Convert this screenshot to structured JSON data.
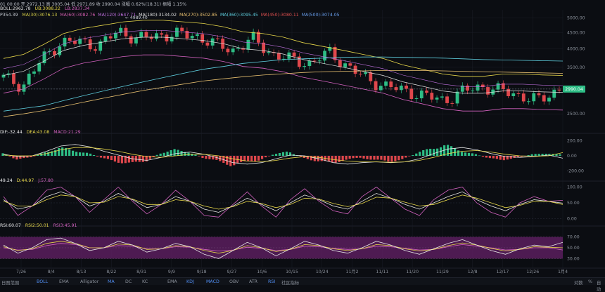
{
  "header": {
    "ohlc_line": "01 00:00  开 2972.13  高 3005.04  低 2971.89  收 2990.04  涨幅 0.62%(18.31)  振幅 1.15%",
    "boll_label": "BOLL:2962.78",
    "boll_ub": "UB:3088.22",
    "boll_lb": "LB:2837.34",
    "ma_line_prefix": "P354.39",
    "ma_values": [
      {
        "text": "MA(30):3076.13",
        "color": "#d9d24a"
      },
      {
        "text": "MA(60):3082.76",
        "color": "#d45fb0"
      },
      {
        "text": "MA(120):3647.71",
        "color": "#c070e0"
      },
      {
        "text": "MA(180):3134.02",
        "color": "#e0e0e0"
      },
      {
        "text": "MA(270):3502.85",
        "color": "#e8c070"
      },
      {
        "text": "MA(360):3095.45",
        "color": "#5fd0e0"
      },
      {
        "text": "MA(450):3080.11",
        "color": "#e05050"
      },
      {
        "text": "MA(500):3074.05",
        "color": "#6aa0f0"
      }
    ],
    "macd_dif": "DIF:-32.44",
    "macd_dea": "DEA:43.08",
    "macd_macd": "MACD:21.29",
    "kdj_k": "49.24",
    "kdj_d": "D:44.97",
    "kdj_j": "J:57.80",
    "rsi_1": "RSI:60.07",
    "rsi_2": "RSI2:50.01",
    "rsi_3": "RSI3:45.91"
  },
  "annotation_high": "4989.40",
  "last_price_tag": "2990.04",
  "colors": {
    "up": "#2dbd85",
    "down": "#e0474c",
    "background": "#0b0d12",
    "grid": "#1a1e26",
    "rsi_band": "#5a1f5e",
    "k_line": "#e8e8e8",
    "d_line": "#e8d84a",
    "j_line": "#d462c0",
    "dif_line": "#e8e8e8",
    "dea_line": "#e8d84a",
    "price_tag": "#2dbd85"
  },
  "toolbar": {
    "items": [
      {
        "label": "日图范围",
        "active": false
      },
      {
        "label": "BOLL",
        "active": true
      },
      {
        "label": "EMA",
        "active": false
      },
      {
        "label": "Alligator",
        "active": false
      },
      {
        "label": "MA",
        "active": true
      },
      {
        "label": "DC",
        "active": false
      },
      {
        "label": "KC",
        "active": false
      },
      {
        "label": "EMA",
        "active": false
      },
      {
        "label": "KDJ",
        "active": true
      },
      {
        "label": "MACD",
        "active": true
      },
      {
        "label": "OBV",
        "active": false
      },
      {
        "label": "ATR",
        "active": false
      },
      {
        "label": "RSI",
        "active": true
      },
      {
        "label": "社区指标",
        "active": false
      }
    ],
    "right": [
      "对数",
      "%",
      "自动"
    ]
  },
  "chart_data": [
    {
      "type": "line",
      "panel": "price",
      "title": "",
      "xlabel": "",
      "ylabel": "",
      "x": [
        "7/26",
        "8/4",
        "8/13",
        "8/22",
        "8/31",
        "9/9",
        "9/18",
        "9/27",
        "10/6",
        "10/15",
        "10/24",
        "11月2",
        "11/11",
        "11/20",
        "11/29",
        "12/8",
        "12/17",
        "12/26",
        "1月4"
      ],
      "y_ticks": [
        5000.0,
        4500.0,
        4000.0,
        3500.0,
        3000.0,
        2500.0
      ],
      "ylim": [
        2250,
        5300
      ],
      "scale": "log",
      "series": [
        {
          "name": "Close",
          "values": [
            3250,
            3050,
            3700,
            4200,
            4200,
            4100,
            4550,
            4300,
            4400,
            4450,
            4400,
            4150,
            3950,
            4300,
            3850,
            3700,
            3600,
            3900,
            3500,
            3200,
            3050,
            2950,
            2850,
            2750,
            2950,
            3050,
            2950,
            2850,
            2750,
            3000
          ]
        },
        {
          "name": "MA(30)",
          "values": [
            3300,
            3400,
            3650,
            3950,
            4100,
            4200,
            4300,
            4350,
            4350,
            4300,
            4250,
            4150,
            4000,
            3950,
            3850,
            3700,
            3600,
            3500,
            3400,
            3300,
            3150,
            3050,
            2950,
            2900,
            2900,
            2950,
            2950,
            2930,
            2920,
            3076
          ]
        },
        {
          "name": "MA(360)",
          "values": [
            2550,
            2600,
            2650,
            2750,
            2850,
            2950,
            3050,
            3150,
            3250,
            3350,
            3450,
            3520,
            3600,
            3650,
            3700,
            3720,
            3740,
            3760,
            3770,
            3770,
            3760,
            3750,
            3740,
            3720,
            3700,
            3690,
            3680,
            3670,
            3660,
            3095
          ]
        },
        {
          "name": "MA(500)",
          "values": [
            2450,
            2500,
            2560,
            2640,
            2720,
            2800,
            2880,
            2960,
            3030,
            3100,
            3170,
            3220,
            3270,
            3310,
            3340,
            3370,
            3390,
            3400,
            3410,
            3420,
            3420,
            3420,
            3410,
            3400,
            3390,
            3380,
            3370,
            3360,
            3350,
            3074
          ]
        }
      ]
    },
    {
      "type": "bar",
      "panel": "macd",
      "y_ticks": [
        200.0,
        0.0,
        -200.0
      ],
      "ylim": [
        -260,
        260
      ],
      "series": [
        {
          "name": "MACD",
          "values": [
            40,
            -60,
            -20,
            60,
            120,
            80,
            40,
            -40,
            -90,
            -120,
            -80,
            40,
            90,
            60,
            -30,
            -80,
            -140,
            -100,
            -60,
            30,
            60,
            -30,
            -80,
            -110,
            -60,
            -30,
            -60,
            -90,
            -50,
            40,
            120,
            160,
            80,
            30,
            -40,
            -60,
            -30,
            20,
            40,
            20
          ]
        },
        {
          "name": "DIF",
          "values": [
            20,
            -10,
            0,
            60,
            130,
            150,
            120,
            60,
            10,
            -40,
            -60,
            -20,
            30,
            50,
            20,
            -30,
            -90,
            -110,
            -90,
            -40,
            10,
            0,
            -40,
            -90,
            -110,
            -90,
            -80,
            -90,
            -80,
            -40,
            30,
            90,
            110,
            80,
            30,
            -10,
            -20,
            -10,
            10,
            -32
          ]
        },
        {
          "name": "DEA",
          "values": [
            10,
            0,
            0,
            30,
            80,
            110,
            110,
            90,
            60,
            20,
            -10,
            -20,
            0,
            20,
            20,
            0,
            -40,
            -70,
            -80,
            -60,
            -30,
            -10,
            -20,
            -50,
            -70,
            -80,
            -80,
            -85,
            -80,
            -60,
            -20,
            30,
            60,
            70,
            50,
            20,
            0,
            -5,
            0,
            43
          ]
        }
      ]
    },
    {
      "type": "line",
      "panel": "kdj",
      "y_ticks": [
        100.0,
        50.0,
        0.0
      ],
      "ylim": [
        -10,
        110
      ],
      "series": [
        {
          "name": "K",
          "values": [
            60,
            30,
            40,
            70,
            85,
            70,
            40,
            55,
            80,
            60,
            35,
            45,
            70,
            55,
            30,
            20,
            40,
            65,
            45,
            25,
            50,
            75,
            60,
            40,
            30,
            55,
            80,
            65,
            45,
            30,
            50,
            70,
            85,
            60,
            40,
            25,
            45,
            60,
            55,
            49
          ]
        },
        {
          "name": "D",
          "values": [
            55,
            40,
            40,
            60,
            75,
            70,
            50,
            52,
            70,
            62,
            45,
            45,
            60,
            55,
            40,
            30,
            38,
            55,
            48,
            35,
            45,
            65,
            62,
            48,
            38,
            48,
            68,
            65,
            52,
            40,
            45,
            60,
            75,
            65,
            50,
            35,
            42,
            55,
            55,
            45
          ]
        },
        {
          "name": "J",
          "values": [
            70,
            10,
            40,
            90,
            100,
            70,
            20,
            60,
            100,
            55,
            15,
            45,
            90,
            55,
            10,
            5,
            45,
            85,
            40,
            5,
            60,
            95,
            55,
            25,
            15,
            70,
            100,
            65,
            30,
            10,
            60,
            90,
            100,
            50,
            20,
            5,
            50,
            70,
            55,
            58
          ]
        }
      ]
    },
    {
      "type": "line",
      "panel": "rsi",
      "y_ticks": [
        70.0,
        50.0,
        30.0
      ],
      "ylim": [
        15,
        85
      ],
      "band": [
        30,
        70
      ],
      "series": [
        {
          "name": "RSI",
          "values": [
            55,
            40,
            50,
            65,
            68,
            58,
            45,
            50,
            62,
            55,
            42,
            48,
            58,
            52,
            38,
            30,
            45,
            60,
            50,
            35,
            48,
            62,
            55,
            45,
            40,
            50,
            62,
            55,
            45,
            38,
            48,
            58,
            65,
            55,
            45,
            38,
            48,
            55,
            52,
            60
          ]
        },
        {
          "name": "RSI2",
          "values": [
            52,
            45,
            48,
            58,
            62,
            58,
            50,
            50,
            57,
            55,
            47,
            48,
            54,
            52,
            45,
            40,
            45,
            54,
            50,
            43,
            47,
            56,
            54,
            48,
            45,
            48,
            56,
            54,
            48,
            44,
            47,
            54,
            59,
            55,
            49,
            44,
            47,
            52,
            51,
            50
          ]
        },
        {
          "name": "RSI3",
          "values": [
            50,
            46,
            47,
            54,
            58,
            56,
            50,
            50,
            54,
            53,
            48,
            48,
            52,
            51,
            47,
            44,
            46,
            51,
            49,
            45,
            47,
            53,
            52,
            49,
            47,
            48,
            53,
            52,
            49,
            46,
            47,
            52,
            56,
            53,
            50,
            46,
            47,
            50,
            50,
            46
          ]
        }
      ]
    }
  ]
}
